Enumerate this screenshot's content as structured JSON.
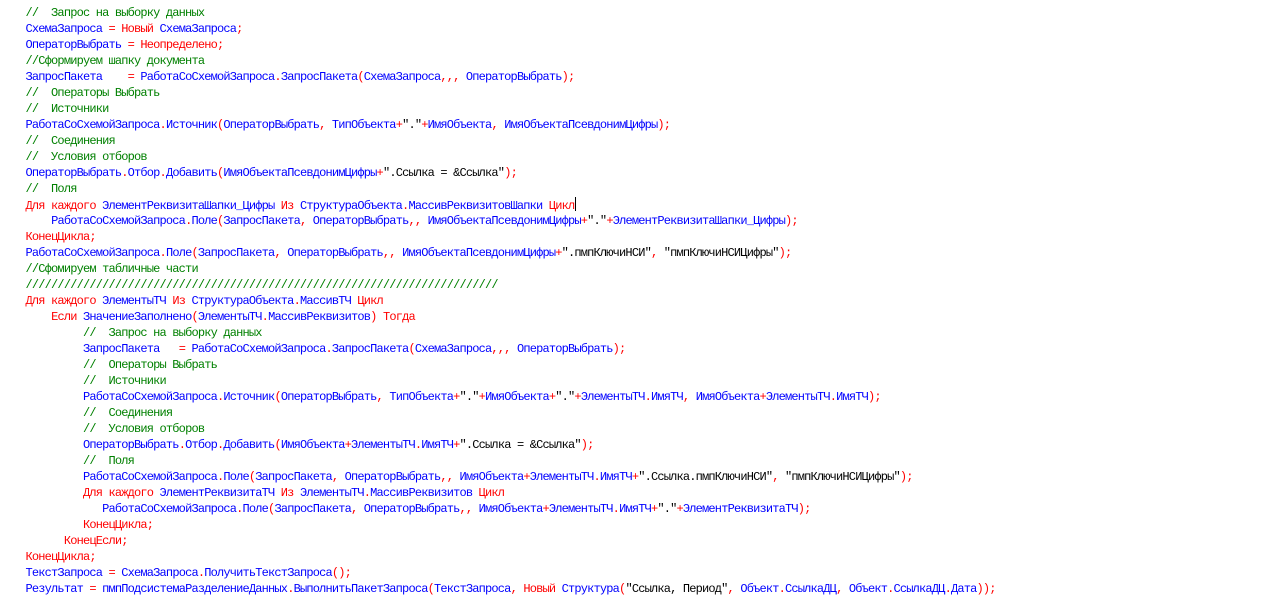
{
  "colors": {
    "comment": "#008000",
    "keyword": "#ff0000",
    "punct": "#ff0000",
    "ident": "#0000ff",
    "string": "#000000"
  },
  "cursor": {
    "line": 12
  },
  "lines": [
    {
      "indent": "    ",
      "tokens": [
        {
          "t": "c",
          "v": "//  Запрос на выборку данных"
        }
      ]
    },
    {
      "indent": "    ",
      "tokens": [
        {
          "t": "i",
          "v": "СхемаЗапроса"
        },
        {
          "t": "p",
          "v": " = "
        },
        {
          "t": "k",
          "v": "Новый"
        },
        {
          "t": "i",
          "v": " СхемаЗапроса"
        },
        {
          "t": "p",
          "v": ";"
        }
      ]
    },
    {
      "indent": "    ",
      "tokens": [
        {
          "t": "i",
          "v": "ОператорВыбрать"
        },
        {
          "t": "p",
          "v": " = "
        },
        {
          "t": "k",
          "v": "Неопределено"
        },
        {
          "t": "p",
          "v": ";"
        }
      ]
    },
    {
      "indent": "    ",
      "tokens": [
        {
          "t": "c",
          "v": "//Сформируем шапку документа"
        }
      ]
    },
    {
      "indent": "    ",
      "tokens": [
        {
          "t": "i",
          "v": "ЗапросПакета"
        },
        {
          "t": "p",
          "v": "    = "
        },
        {
          "t": "i",
          "v": "РаботаСоСхемойЗапроса"
        },
        {
          "t": "p",
          "v": "."
        },
        {
          "t": "i",
          "v": "ЗапросПакета"
        },
        {
          "t": "p",
          "v": "("
        },
        {
          "t": "i",
          "v": "СхемаЗапроса"
        },
        {
          "t": "p",
          "v": ",,, "
        },
        {
          "t": "i",
          "v": "ОператорВыбрать"
        },
        {
          "t": "p",
          "v": ");"
        }
      ]
    },
    {
      "indent": "    ",
      "tokens": [
        {
          "t": "c",
          "v": "//  Операторы Выбрать"
        }
      ]
    },
    {
      "indent": "    ",
      "tokens": [
        {
          "t": "c",
          "v": "//  Источники"
        }
      ]
    },
    {
      "indent": "    ",
      "tokens": [
        {
          "t": "i",
          "v": "РаботаСоСхемойЗапроса"
        },
        {
          "t": "p",
          "v": "."
        },
        {
          "t": "i",
          "v": "Источник"
        },
        {
          "t": "p",
          "v": "("
        },
        {
          "t": "i",
          "v": "ОператорВыбрать"
        },
        {
          "t": "p",
          "v": ", "
        },
        {
          "t": "i",
          "v": "ТипОбъекта"
        },
        {
          "t": "p",
          "v": "+"
        },
        {
          "t": "s",
          "v": "\".\""
        },
        {
          "t": "p",
          "v": "+"
        },
        {
          "t": "i",
          "v": "ИмяОбъекта"
        },
        {
          "t": "p",
          "v": ", "
        },
        {
          "t": "i",
          "v": "ИмяОбъектаПсевдонимЦифры"
        },
        {
          "t": "p",
          "v": ");"
        }
      ]
    },
    {
      "indent": "    ",
      "tokens": [
        {
          "t": "c",
          "v": "//  Соединения"
        }
      ]
    },
    {
      "indent": "    ",
      "tokens": [
        {
          "t": "c",
          "v": "//  Условия отборов"
        }
      ]
    },
    {
      "indent": "    ",
      "tokens": [
        {
          "t": "i",
          "v": "ОператорВыбрать"
        },
        {
          "t": "p",
          "v": "."
        },
        {
          "t": "i",
          "v": "Отбор"
        },
        {
          "t": "p",
          "v": "."
        },
        {
          "t": "i",
          "v": "Добавить"
        },
        {
          "t": "p",
          "v": "("
        },
        {
          "t": "i",
          "v": "ИмяОбъектаПсевдонимЦифры"
        },
        {
          "t": "p",
          "v": "+"
        },
        {
          "t": "s",
          "v": "\".Ссылка = &Ссылка\""
        },
        {
          "t": "p",
          "v": ");"
        }
      ]
    },
    {
      "indent": "    ",
      "tokens": [
        {
          "t": "c",
          "v": "//  Поля"
        }
      ]
    },
    {
      "indent": "    ",
      "tokens": [
        {
          "t": "k",
          "v": "Для каждого"
        },
        {
          "t": "i",
          "v": " ЭлементРеквизитаШапки_Цифры "
        },
        {
          "t": "k",
          "v": "Из"
        },
        {
          "t": "i",
          "v": " СтруктураОбъекта"
        },
        {
          "t": "p",
          "v": "."
        },
        {
          "t": "i",
          "v": "МассивРеквизитовШапки "
        },
        {
          "t": "k",
          "v": "Цикл"
        }
      ]
    },
    {
      "indent": "        ",
      "tokens": [
        {
          "t": "i",
          "v": "РаботаСоСхемойЗапроса"
        },
        {
          "t": "p",
          "v": "."
        },
        {
          "t": "i",
          "v": "Поле"
        },
        {
          "t": "p",
          "v": "("
        },
        {
          "t": "i",
          "v": "ЗапросПакета"
        },
        {
          "t": "p",
          "v": ", "
        },
        {
          "t": "i",
          "v": "ОператорВыбрать"
        },
        {
          "t": "p",
          "v": ",, "
        },
        {
          "t": "i",
          "v": "ИмяОбъектаПсевдонимЦифры"
        },
        {
          "t": "p",
          "v": "+"
        },
        {
          "t": "s",
          "v": "\".\""
        },
        {
          "t": "p",
          "v": "+"
        },
        {
          "t": "i",
          "v": "ЭлементРеквизитаШапки_Цифры"
        },
        {
          "t": "p",
          "v": ");"
        }
      ]
    },
    {
      "indent": "    ",
      "tokens": [
        {
          "t": "k",
          "v": "КонецЦикла"
        },
        {
          "t": "p",
          "v": ";"
        }
      ]
    },
    {
      "indent": "    ",
      "tokens": [
        {
          "t": "i",
          "v": "РаботаСоСхемойЗапроса"
        },
        {
          "t": "p",
          "v": "."
        },
        {
          "t": "i",
          "v": "Поле"
        },
        {
          "t": "p",
          "v": "("
        },
        {
          "t": "i",
          "v": "ЗапросПакета"
        },
        {
          "t": "p",
          "v": ", "
        },
        {
          "t": "i",
          "v": "ОператорВыбрать"
        },
        {
          "t": "p",
          "v": ",, "
        },
        {
          "t": "i",
          "v": "ИмяОбъектаПсевдонимЦифры"
        },
        {
          "t": "p",
          "v": "+"
        },
        {
          "t": "s",
          "v": "\".пмпКлючиНСИ\""
        },
        {
          "t": "p",
          "v": ", "
        },
        {
          "t": "s",
          "v": "\"пмпКлючиНСИЦифры\""
        },
        {
          "t": "p",
          "v": ");"
        }
      ]
    },
    {
      "indent": "    ",
      "tokens": [
        {
          "t": "c",
          "v": "//Сфомируем табличные части"
        }
      ]
    },
    {
      "indent": "    ",
      "tokens": [
        {
          "t": "c",
          "v": "//////////////////////////////////////////////////////////////////////////"
        }
      ]
    },
    {
      "indent": "    ",
      "tokens": [
        {
          "t": "k",
          "v": "Для каждого"
        },
        {
          "t": "i",
          "v": " ЭлементыТЧ "
        },
        {
          "t": "k",
          "v": "Из"
        },
        {
          "t": "i",
          "v": " СтруктураОбъекта"
        },
        {
          "t": "p",
          "v": "."
        },
        {
          "t": "i",
          "v": "МассивТЧ "
        },
        {
          "t": "k",
          "v": "Цикл"
        }
      ]
    },
    {
      "indent": "        ",
      "tokens": [
        {
          "t": "k",
          "v": "Если"
        },
        {
          "t": "i",
          "v": " ЗначениеЗаполнено"
        },
        {
          "t": "p",
          "v": "("
        },
        {
          "t": "i",
          "v": "ЭлементыТЧ"
        },
        {
          "t": "p",
          "v": "."
        },
        {
          "t": "i",
          "v": "МассивРеквизитов"
        },
        {
          "t": "p",
          "v": ") "
        },
        {
          "t": "k",
          "v": "Тогда"
        }
      ]
    },
    {
      "indent": "             ",
      "tokens": [
        {
          "t": "c",
          "v": "//  Запрос на выборку данных"
        }
      ]
    },
    {
      "indent": "             ",
      "tokens": [
        {
          "t": "i",
          "v": "ЗапросПакета"
        },
        {
          "t": "p",
          "v": "   = "
        },
        {
          "t": "i",
          "v": "РаботаСоСхемойЗапроса"
        },
        {
          "t": "p",
          "v": "."
        },
        {
          "t": "i",
          "v": "ЗапросПакета"
        },
        {
          "t": "p",
          "v": "("
        },
        {
          "t": "i",
          "v": "СхемаЗапроса"
        },
        {
          "t": "p",
          "v": ",,, "
        },
        {
          "t": "i",
          "v": "ОператорВыбрать"
        },
        {
          "t": "p",
          "v": ");"
        }
      ]
    },
    {
      "indent": "             ",
      "tokens": [
        {
          "t": "c",
          "v": "//  Операторы Выбрать"
        }
      ]
    },
    {
      "indent": "             ",
      "tokens": [
        {
          "t": "c",
          "v": "//  Источники"
        }
      ]
    },
    {
      "indent": "             ",
      "tokens": [
        {
          "t": "i",
          "v": "РаботаСоСхемойЗапроса"
        },
        {
          "t": "p",
          "v": "."
        },
        {
          "t": "i",
          "v": "Источник"
        },
        {
          "t": "p",
          "v": "("
        },
        {
          "t": "i",
          "v": "ОператорВыбрать"
        },
        {
          "t": "p",
          "v": ", "
        },
        {
          "t": "i",
          "v": "ТипОбъекта"
        },
        {
          "t": "p",
          "v": "+"
        },
        {
          "t": "s",
          "v": "\".\""
        },
        {
          "t": "p",
          "v": "+"
        },
        {
          "t": "i",
          "v": "ИмяОбъекта"
        },
        {
          "t": "p",
          "v": "+"
        },
        {
          "t": "s",
          "v": "\".\""
        },
        {
          "t": "p",
          "v": "+"
        },
        {
          "t": "i",
          "v": "ЭлементыТЧ"
        },
        {
          "t": "p",
          "v": "."
        },
        {
          "t": "i",
          "v": "ИмяТЧ"
        },
        {
          "t": "p",
          "v": ", "
        },
        {
          "t": "i",
          "v": "ИмяОбъекта"
        },
        {
          "t": "p",
          "v": "+"
        },
        {
          "t": "i",
          "v": "ЭлементыТЧ"
        },
        {
          "t": "p",
          "v": "."
        },
        {
          "t": "i",
          "v": "ИмяТЧ"
        },
        {
          "t": "p",
          "v": ");"
        }
      ]
    },
    {
      "indent": "             ",
      "tokens": [
        {
          "t": "c",
          "v": "//  Соединения"
        }
      ]
    },
    {
      "indent": "             ",
      "tokens": [
        {
          "t": "c",
          "v": "//  Условия отборов"
        }
      ]
    },
    {
      "indent": "             ",
      "tokens": [
        {
          "t": "i",
          "v": "ОператорВыбрать"
        },
        {
          "t": "p",
          "v": "."
        },
        {
          "t": "i",
          "v": "Отбор"
        },
        {
          "t": "p",
          "v": "."
        },
        {
          "t": "i",
          "v": "Добавить"
        },
        {
          "t": "p",
          "v": "("
        },
        {
          "t": "i",
          "v": "ИмяОбъекта"
        },
        {
          "t": "p",
          "v": "+"
        },
        {
          "t": "i",
          "v": "ЭлементыТЧ"
        },
        {
          "t": "p",
          "v": "."
        },
        {
          "t": "i",
          "v": "ИмяТЧ"
        },
        {
          "t": "p",
          "v": "+"
        },
        {
          "t": "s",
          "v": "\".Ссылка = &Ссылка\""
        },
        {
          "t": "p",
          "v": ");"
        }
      ]
    },
    {
      "indent": "             ",
      "tokens": [
        {
          "t": "c",
          "v": "//  Поля"
        }
      ]
    },
    {
      "indent": "             ",
      "tokens": [
        {
          "t": "i",
          "v": "РаботаСоСхемойЗапроса"
        },
        {
          "t": "p",
          "v": "."
        },
        {
          "t": "i",
          "v": "Поле"
        },
        {
          "t": "p",
          "v": "("
        },
        {
          "t": "i",
          "v": "ЗапросПакета"
        },
        {
          "t": "p",
          "v": ", "
        },
        {
          "t": "i",
          "v": "ОператорВыбрать"
        },
        {
          "t": "p",
          "v": ",, "
        },
        {
          "t": "i",
          "v": "ИмяОбъекта"
        },
        {
          "t": "p",
          "v": "+"
        },
        {
          "t": "i",
          "v": "ЭлементыТЧ"
        },
        {
          "t": "p",
          "v": "."
        },
        {
          "t": "i",
          "v": "ИмяТЧ"
        },
        {
          "t": "p",
          "v": "+"
        },
        {
          "t": "s",
          "v": "\".Ссылка.пмпКлючиНСИ\""
        },
        {
          "t": "p",
          "v": ", "
        },
        {
          "t": "s",
          "v": "\"пмпКлючиНСИЦифры\""
        },
        {
          "t": "p",
          "v": ");"
        }
      ]
    },
    {
      "indent": "             ",
      "tokens": [
        {
          "t": "k",
          "v": "Для каждого"
        },
        {
          "t": "i",
          "v": " ЭлементРеквизитаТЧ "
        },
        {
          "t": "k",
          "v": "Из"
        },
        {
          "t": "i",
          "v": " ЭлементыТЧ"
        },
        {
          "t": "p",
          "v": "."
        },
        {
          "t": "i",
          "v": "МассивРеквизитов "
        },
        {
          "t": "k",
          "v": "Цикл"
        }
      ]
    },
    {
      "indent": "                ",
      "tokens": [
        {
          "t": "i",
          "v": "РаботаСоСхемойЗапроса"
        },
        {
          "t": "p",
          "v": "."
        },
        {
          "t": "i",
          "v": "Поле"
        },
        {
          "t": "p",
          "v": "("
        },
        {
          "t": "i",
          "v": "ЗапросПакета"
        },
        {
          "t": "p",
          "v": ", "
        },
        {
          "t": "i",
          "v": "ОператорВыбрать"
        },
        {
          "t": "p",
          "v": ",, "
        },
        {
          "t": "i",
          "v": "ИмяОбъекта"
        },
        {
          "t": "p",
          "v": "+"
        },
        {
          "t": "i",
          "v": "ЭлементыТЧ"
        },
        {
          "t": "p",
          "v": "."
        },
        {
          "t": "i",
          "v": "ИмяТЧ"
        },
        {
          "t": "p",
          "v": "+"
        },
        {
          "t": "s",
          "v": "\".\""
        },
        {
          "t": "p",
          "v": "+"
        },
        {
          "t": "i",
          "v": "ЭлементРеквизитаТЧ"
        },
        {
          "t": "p",
          "v": ");"
        }
      ]
    },
    {
      "indent": "             ",
      "tokens": [
        {
          "t": "k",
          "v": "КонецЦикла"
        },
        {
          "t": "p",
          "v": ";"
        }
      ]
    },
    {
      "indent": "          ",
      "tokens": [
        {
          "t": "k",
          "v": "КонецЕсли"
        },
        {
          "t": "p",
          "v": ";"
        }
      ]
    },
    {
      "indent": "    ",
      "tokens": [
        {
          "t": "k",
          "v": "КонецЦикла"
        },
        {
          "t": "p",
          "v": ";"
        }
      ]
    },
    {
      "indent": "    ",
      "tokens": [
        {
          "t": "i",
          "v": "ТекстЗапроса"
        },
        {
          "t": "p",
          "v": " = "
        },
        {
          "t": "i",
          "v": "СхемаЗапроса"
        },
        {
          "t": "p",
          "v": "."
        },
        {
          "t": "i",
          "v": "ПолучитьТекстЗапроса"
        },
        {
          "t": "p",
          "v": "();"
        }
      ]
    },
    {
      "indent": "    ",
      "tokens": [
        {
          "t": "i",
          "v": "Результат"
        },
        {
          "t": "p",
          "v": " = "
        },
        {
          "t": "i",
          "v": "пмпПодсистемаРазделениеДанных"
        },
        {
          "t": "p",
          "v": "."
        },
        {
          "t": "i",
          "v": "ВыполнитьПакетЗапроса"
        },
        {
          "t": "p",
          "v": "("
        },
        {
          "t": "i",
          "v": "ТекстЗапроса"
        },
        {
          "t": "p",
          "v": ", "
        },
        {
          "t": "k",
          "v": "Новый"
        },
        {
          "t": "i",
          "v": " Структура"
        },
        {
          "t": "p",
          "v": "("
        },
        {
          "t": "s",
          "v": "\"Ссылка, Период\""
        },
        {
          "t": "p",
          "v": ", "
        },
        {
          "t": "i",
          "v": "Объект"
        },
        {
          "t": "p",
          "v": "."
        },
        {
          "t": "i",
          "v": "СсылкаДЦ"
        },
        {
          "t": "p",
          "v": ", "
        },
        {
          "t": "i",
          "v": "Объект"
        },
        {
          "t": "p",
          "v": "."
        },
        {
          "t": "i",
          "v": "СсылкаДЦ"
        },
        {
          "t": "p",
          "v": "."
        },
        {
          "t": "i",
          "v": "Дата"
        },
        {
          "t": "p",
          "v": "));"
        }
      ]
    }
  ]
}
